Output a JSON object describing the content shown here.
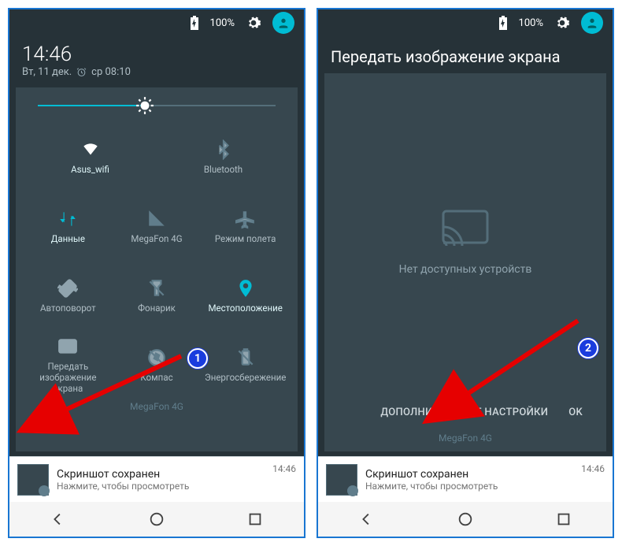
{
  "status": {
    "battery": "100%"
  },
  "s1": {
    "clock": "14:46",
    "date": "Вт, 11 дек.",
    "alarm": "ср 08:10",
    "tiles": {
      "wifi": "Asus_wifi",
      "bt": "Bluetooth",
      "data": "Данные",
      "signal": "MegaFon 4G",
      "airplane": "Режим полета",
      "rotate": "Автоповорот",
      "flash": "Фонарик",
      "location": "Местоположение",
      "cast": "Передать\nизображение экрана",
      "compass": "Компас",
      "battery": "Энергосбережение"
    },
    "carrier": "MegaFon 4G"
  },
  "s2": {
    "title": "Передать изображение экрана",
    "empty": "Нет доступных устройств",
    "more": "ДОПОЛНИТЕЛЬНЫЕ НАСТРОЙКИ",
    "ok": "OK",
    "carrier": "MegaFon 4G"
  },
  "notif": {
    "title": "Скриншот сохранен",
    "sub": "Нажмите, чтобы просмотреть",
    "ts": "14:46"
  },
  "annot": {
    "b1": "1",
    "b2": "2"
  }
}
